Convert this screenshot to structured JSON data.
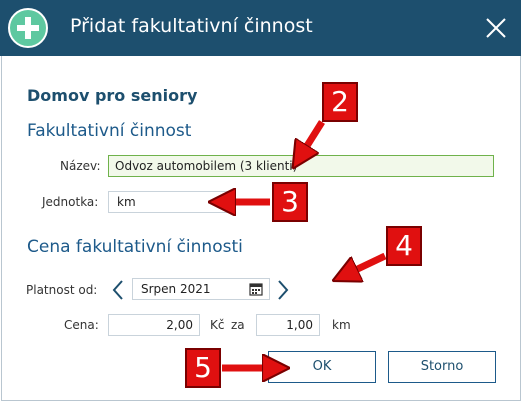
{
  "dialog": {
    "title": "Přidat fakultativní činnost"
  },
  "org_name": "Domov pro seniory",
  "section_activity": {
    "heading": "Fakultativní činnost",
    "name_label": "Název:",
    "name_value": "Odvoz automobilem (3 klienti)",
    "unit_label": "Jednotka:",
    "unit_value": "km"
  },
  "section_price": {
    "heading": "Cena fakultativní činnosti",
    "valid_from_label": "Platnost od:",
    "valid_from_value": "Srpen 2021",
    "price_label": "Cena:",
    "price_value": "2,00",
    "currency": "Kč",
    "per_label": "za",
    "quantity_value": "1,00",
    "quantity_unit": "km"
  },
  "buttons": {
    "ok": "OK",
    "cancel": "Storno"
  },
  "callouts": {
    "c2": "2",
    "c3": "3",
    "c4": "4",
    "c5": "5"
  },
  "colors": {
    "titlebar": "#1d4f6e",
    "accent_green": "#5ec8a0",
    "callout_red": "#e01010",
    "heading_blue": "#1d5a8a"
  }
}
